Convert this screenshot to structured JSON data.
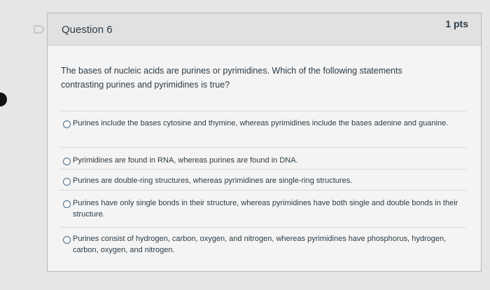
{
  "question": {
    "title": "Question 6",
    "points": "1 pts",
    "text": "The bases of nucleic acids are purines or pyrimidines. Which of the following statements contrasting purines and pyrimidines is true?"
  },
  "answers": [
    {
      "label": "Purines include the bases cytosine and thymine, whereas pyrimidines include the bases adenine and guanine."
    },
    {
      "label": "Pyrimidines are found in RNA, whereas purines are found in DNA."
    },
    {
      "label": "Purines are double-ring structures, whereas pyrimidines are single-ring structures."
    },
    {
      "label": "Purines have only single bonds in their structure, whereas pyrimidines have both single and double bonds in their structure."
    },
    {
      "label": "Purines consist of hydrogen, carbon, oxygen, and nitrogen, whereas pyrimidines have phosphorus, hydrogen, carbon, oxygen, and nitrogen."
    }
  ],
  "colors": {
    "text": "#2d3b45",
    "header_bg": "#e1e1e1",
    "card_bg": "#f4f4f4",
    "flag_icon": "#cccccc"
  },
  "icons": {
    "flag": "flag-icon"
  }
}
